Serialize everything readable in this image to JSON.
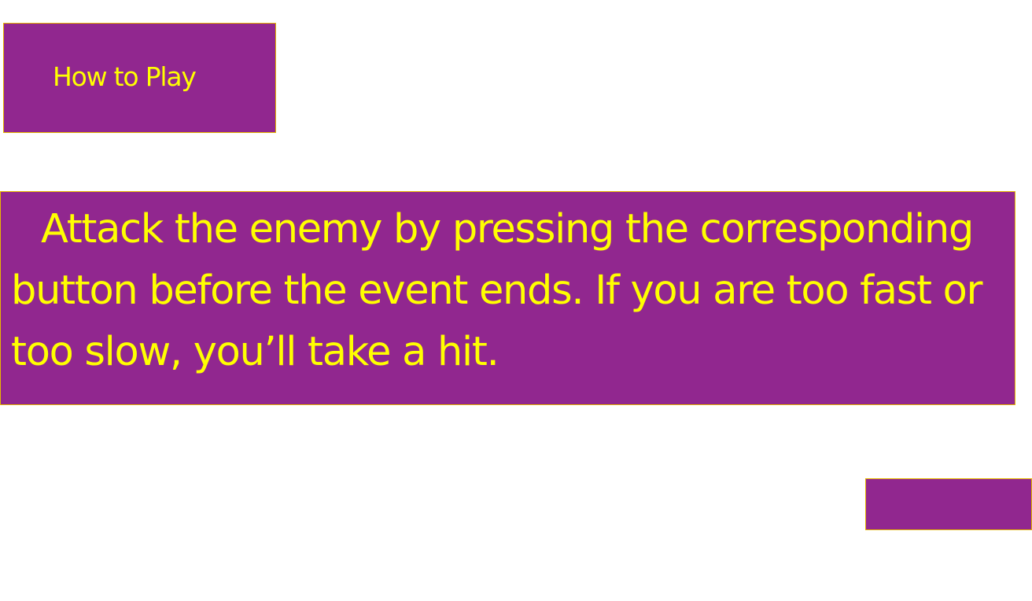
{
  "colors": {
    "panel_bg": "#91278f",
    "text": "#ffff00",
    "border": "#e6b800",
    "page_bg": "#ffffff"
  },
  "title": {
    "label": "How to Play"
  },
  "instructions": {
    "text": "Attack the enemy by pressing the corresponding button before the event ends. If you are too fast or too slow, you’ll take a hit."
  },
  "continue_button": {
    "label": ""
  }
}
